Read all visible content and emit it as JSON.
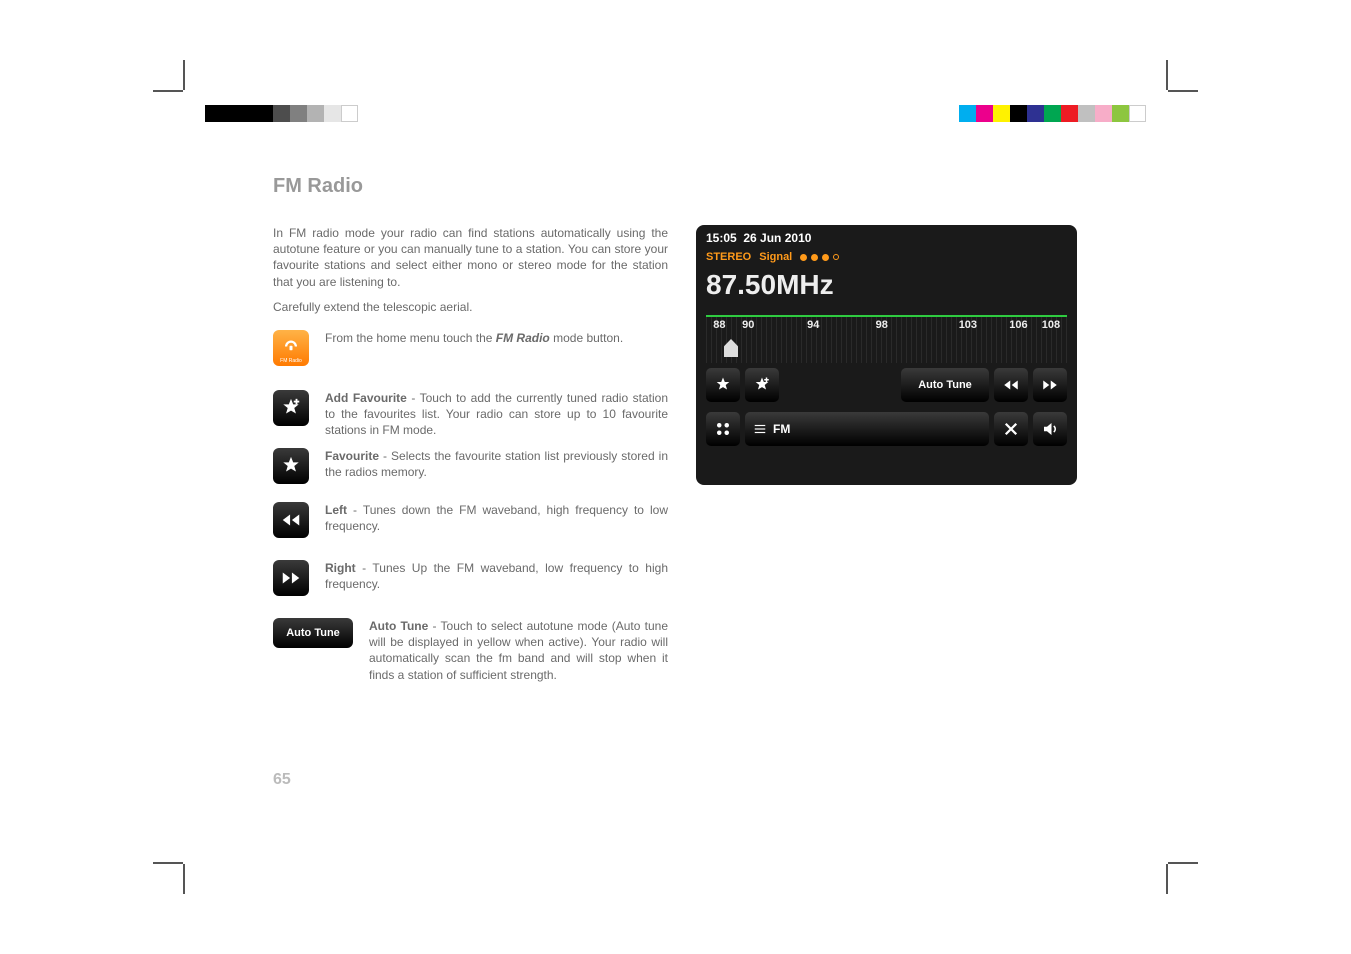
{
  "title": "FM Radio",
  "intro": "In FM radio mode your radio can find stations automatically using the autotune feature or you can manually tune to a station. You can store your favourite stations and select either mono or stereo mode for the station that you are listening to.",
  "aerial": "Carefully extend the telescopic aerial.",
  "rows": {
    "fm_pre": "From the home menu touch the ",
    "fm_bold": "FM Radio",
    "fm_post": " mode button.",
    "addfav_b": "Add Favourite",
    "addfav": " - Touch to add the currently tuned radio station to the favourites list. Your radio can store up to 10 favourite stations in FM mode.",
    "fav_b": "Favourite",
    "fav": " - Selects the favourite station list previously stored in the radios memory.",
    "left_b": "Left",
    "left": " - Tunes down the FM waveband, high frequency to low frequency.",
    "right_b": "Right",
    "right": " - Tunes Up the FM waveband, low frequency to high frequency.",
    "auto_b": "Auto Tune",
    "auto": " - Touch to select autotune mode (Auto tune will be displayed in yellow when active). Your radio will automatically scan the fm band and will stop when it finds a station of sufficient strength."
  },
  "autotune_btn": "Auto Tune",
  "fm_icon_label": "FM Radio",
  "pagenum": "65",
  "screen": {
    "time": "15:05",
    "date": "26 Jun 2010",
    "stereo": "STEREO",
    "signal": "Signal",
    "freq": "87.50MHz",
    "ticks": [
      "88",
      "90",
      "94",
      "98",
      "103",
      "106",
      "108"
    ],
    "autotune": "Auto Tune",
    "fm": "FM"
  },
  "cal_left": [
    "#000000",
    "#000000",
    "#000000",
    "#000000",
    "#4d4d4d",
    "#808080",
    "#b3b3b3",
    "#e6e6e6",
    "#ffffff"
  ],
  "cal_right": [
    "#00aeef",
    "#ec008c",
    "#fff200",
    "#000000",
    "#2e3192",
    "#00a651",
    "#ed1c24",
    "#c0c0c0",
    "#f7adc8",
    "#8dc63f",
    "#ffffff"
  ]
}
